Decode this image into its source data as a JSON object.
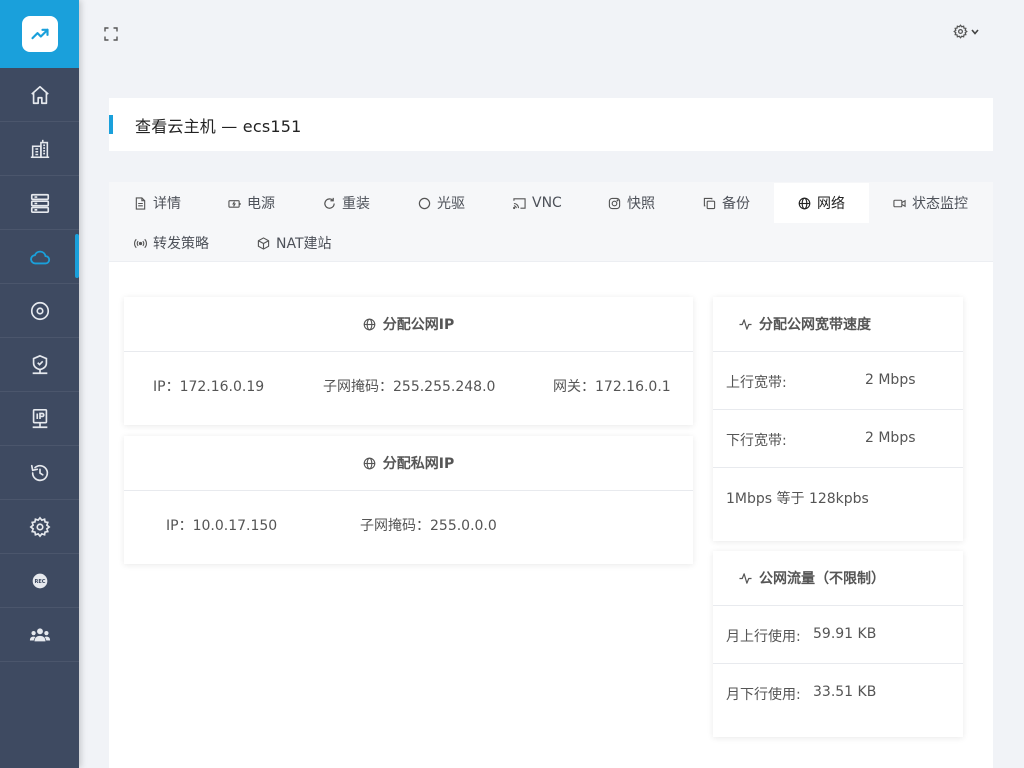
{
  "page_title": "查看云主机 — ecs151",
  "tabs": [
    {
      "label": "详情",
      "icon": "document-icon"
    },
    {
      "label": "电源",
      "icon": "power-icon"
    },
    {
      "label": "重装",
      "icon": "refresh-icon"
    },
    {
      "label": "光驱",
      "icon": "circle-icon"
    },
    {
      "label": "VNC",
      "icon": "cast-icon"
    },
    {
      "label": "快照",
      "icon": "camera-icon"
    },
    {
      "label": "备份",
      "icon": "copy-icon"
    },
    {
      "label": "网络",
      "icon": "globe-icon",
      "active": true
    },
    {
      "label": "状态监控",
      "icon": "video-icon"
    },
    {
      "label": "转发策略",
      "icon": "broadcast-icon"
    },
    {
      "label": "NAT建站",
      "icon": "box-icon"
    }
  ],
  "public_ip": {
    "title": "分配公网IP",
    "ip": "IP：172.16.0.19",
    "mask": "子网掩码：255.255.248.0",
    "gateway": "网关：172.16.0.1"
  },
  "private_ip": {
    "title": "分配私网IP",
    "ip": "IP：10.0.17.150",
    "mask": "子网掩码：255.0.0.0"
  },
  "bandwidth": {
    "title": "分配公网宽带速度",
    "up_label": "上行宽带:",
    "up_value": "2 Mbps",
    "down_label": "下行宽带:",
    "down_value": "2 Mbps",
    "note": "1Mbps 等于 128kpbs"
  },
  "traffic": {
    "title": "公网流量（不限制）",
    "up_label": "月上行使用:",
    "up_value": "59.91 KB",
    "down_label": "月下行使用:",
    "down_value": "33.51 KB"
  },
  "colors": {
    "accent": "#1aa0db",
    "sidebar": "#3e4a61"
  }
}
